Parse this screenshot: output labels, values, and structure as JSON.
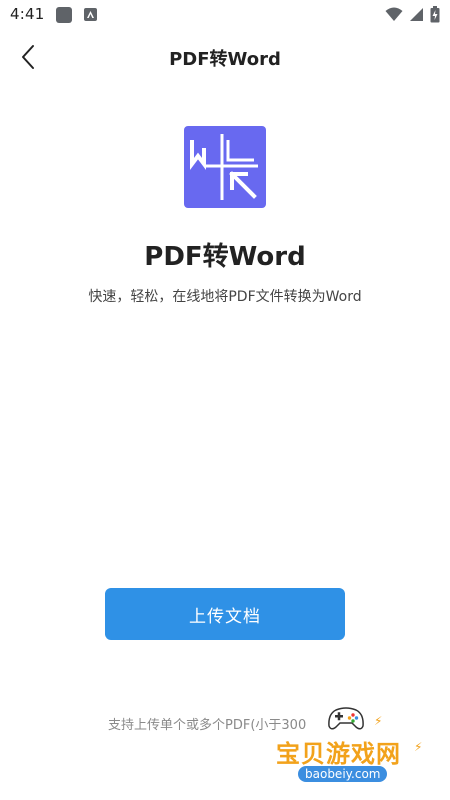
{
  "status_bar": {
    "time": "4:41"
  },
  "header": {
    "title": "PDF转Word"
  },
  "hero": {
    "title": "PDF转Word",
    "description": "快速，轻松，在线地将PDF文件转换为Word"
  },
  "actions": {
    "upload_label": "上传文档"
  },
  "hint": {
    "text": "支持上传单个或多个PDF(小于300"
  },
  "watermark": {
    "brand": "宝贝游戏网",
    "url": "baobeiy.com"
  },
  "colors": {
    "accent": "#2f91e6",
    "logo": "#6869f0",
    "watermark_text": "#f2a21b"
  }
}
